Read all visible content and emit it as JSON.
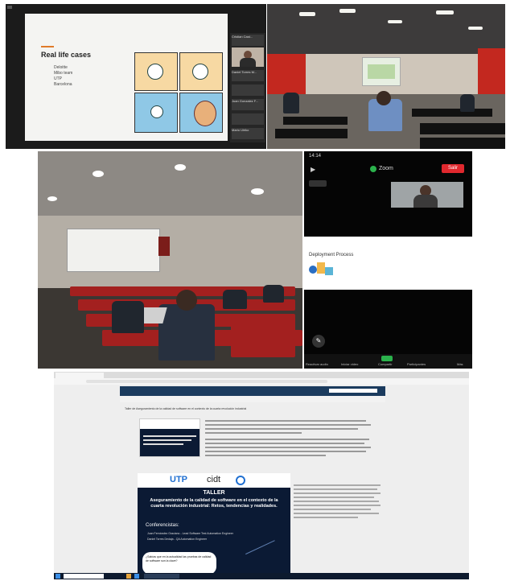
{
  "panel1": {
    "slide_title": "Real life cases",
    "bullets": [
      "Deloitte",
      "Mibo team",
      "UTP",
      "Barcelona"
    ],
    "participants": [
      "Cristian Cast...",
      "",
      "Daniel Torres M...",
      "",
      "Juan Gonzalez F...",
      "",
      "Mario Ulriko",
      ""
    ]
  },
  "panel4": {
    "status_time": "14:14",
    "zoom_label": "Zoom",
    "leave_label": "Salir",
    "slide_title": "Deployment Process",
    "bottom_labels": [
      "Reactivar audio",
      "Iniciar video",
      "Compartir",
      "Participantes",
      "Más"
    ]
  },
  "panel5": {
    "page_title": "Taller de Aseguramiento de la calidad de software en el contexto de la cuarta revolución industrial",
    "poster": {
      "logo_utp": "UTP",
      "logo_cidt": "cidt",
      "heading": "TALLER",
      "title": "Aseguramiento de la calidad de software en el contexto de la cuarta revolución industrial: Retos, tendencias y realidades.",
      "conferencistas_label": "Conferencistas:",
      "speaker1": "Juan Fernández Graciano - Lead Software Test Automation Engineer",
      "speaker2": "Daniel Torres Dedaja - QA Automation Engineer",
      "question": "¿Sabías que en la actualidad las pruebas de calidad de software son la clave?"
    }
  },
  "colors": {
    "seat_red": "#a3201f",
    "zoom_red": "#e0282e",
    "zoom_green": "#2bb24c",
    "poster_dark": "#0b1a34",
    "utp_blue": "#1f6fd1"
  }
}
